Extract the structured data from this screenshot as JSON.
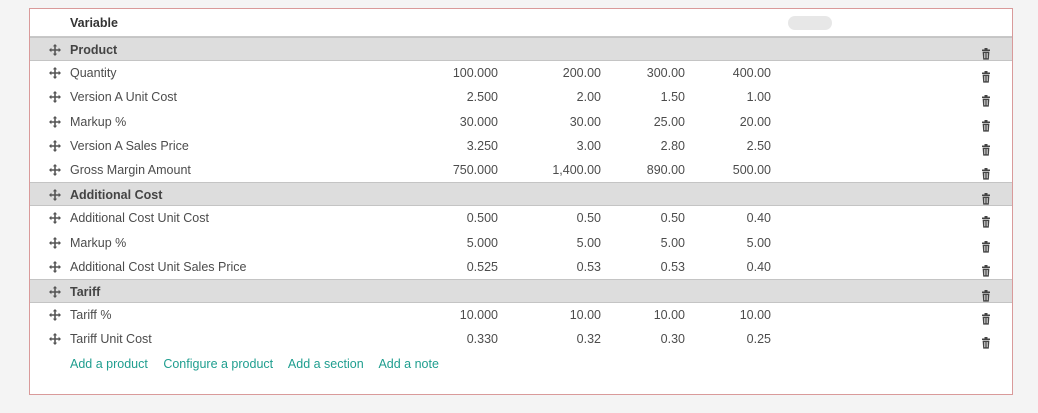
{
  "table": {
    "header": {
      "label": "Variable"
    },
    "rows": [
      {
        "kind": "section",
        "label": "Product"
      },
      {
        "kind": "line",
        "label": "Quantity",
        "v1": "100.000",
        "v2": "200.00",
        "v3": "300.00",
        "v4": "400.00"
      },
      {
        "kind": "line",
        "label": "Version A Unit Cost",
        "v1": "2.500",
        "v2": "2.00",
        "v3": "1.50",
        "v4": "1.00"
      },
      {
        "kind": "line",
        "label": "Markup %",
        "v1": "30.000",
        "v2": "30.00",
        "v3": "25.00",
        "v4": "20.00"
      },
      {
        "kind": "line",
        "label": "Version A Sales Price",
        "v1": "3.250",
        "v2": "3.00",
        "v3": "2.80",
        "v4": "2.50"
      },
      {
        "kind": "line",
        "label": "Gross Margin Amount",
        "v1": "750.000",
        "v2": "1,400.00",
        "v3": "890.00",
        "v4": "500.00"
      },
      {
        "kind": "section",
        "label": "Additional Cost"
      },
      {
        "kind": "line",
        "label": "Additional Cost Unit Cost",
        "v1": "0.500",
        "v2": "0.50",
        "v3": "0.50",
        "v4": "0.40"
      },
      {
        "kind": "line",
        "label": "Markup %",
        "v1": "5.000",
        "v2": "5.00",
        "v3": "5.00",
        "v4": "5.00"
      },
      {
        "kind": "line",
        "label": "Additional Cost Unit Sales Price",
        "v1": "0.525",
        "v2": "0.53",
        "v3": "0.53",
        "v4": "0.40"
      },
      {
        "kind": "section",
        "label": "Tariff"
      },
      {
        "kind": "line",
        "label": "Tariff %",
        "v1": "10.000",
        "v2": "10.00",
        "v3": "10.00",
        "v4": "10.00"
      },
      {
        "kind": "line",
        "label": "Tariff Unit Cost",
        "v1": "0.330",
        "v2": "0.32",
        "v3": "0.30",
        "v4": "0.25"
      }
    ]
  },
  "actions": {
    "add_product": "Add a product",
    "configure_product": "Configure a product",
    "add_section": "Add a section",
    "add_note": "Add a note"
  },
  "colors": {
    "link": "#1f9e8f",
    "section_bg": "#dddddd",
    "border": "#d99a9a"
  },
  "icons": {
    "handle": "arrows-move-icon",
    "delete": "trash-icon"
  }
}
